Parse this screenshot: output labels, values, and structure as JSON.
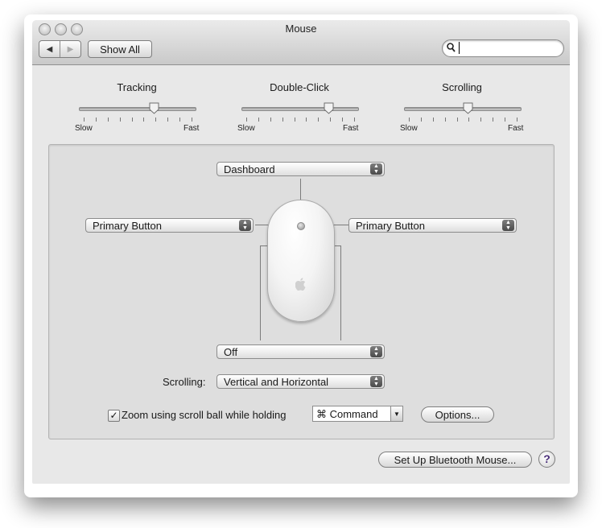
{
  "window": {
    "title": "Mouse"
  },
  "toolbar": {
    "back_icon": "◀",
    "forward_icon": "▶",
    "show_all_label": "Show All",
    "search_icon": "🔍",
    "search_value": ""
  },
  "sliders": [
    {
      "label": "Tracking",
      "min_label": "Slow",
      "max_label": "Fast",
      "value": 0.66
    },
    {
      "label": "Double-Click",
      "min_label": "Slow",
      "max_label": "Fast",
      "value": 0.77
    },
    {
      "label": "Scrolling",
      "min_label": "Slow",
      "max_label": "Fast",
      "value": 0.55
    }
  ],
  "buttons_config": {
    "top": "Dashboard",
    "left": "Primary Button",
    "right": "Primary Button",
    "side": "Off",
    "scrolling_label": "Scrolling:",
    "scrolling_value": "Vertical and Horizontal"
  },
  "zoom": {
    "checked": true,
    "check_glyph": "✓",
    "label": "Zoom using scroll ball while holding",
    "modifier": "⌘ Command",
    "dropdown_icon": "▼",
    "options_label": "Options..."
  },
  "footer": {
    "bluetooth_label": "Set Up Bluetooth Mouse...",
    "help_label": "?"
  }
}
